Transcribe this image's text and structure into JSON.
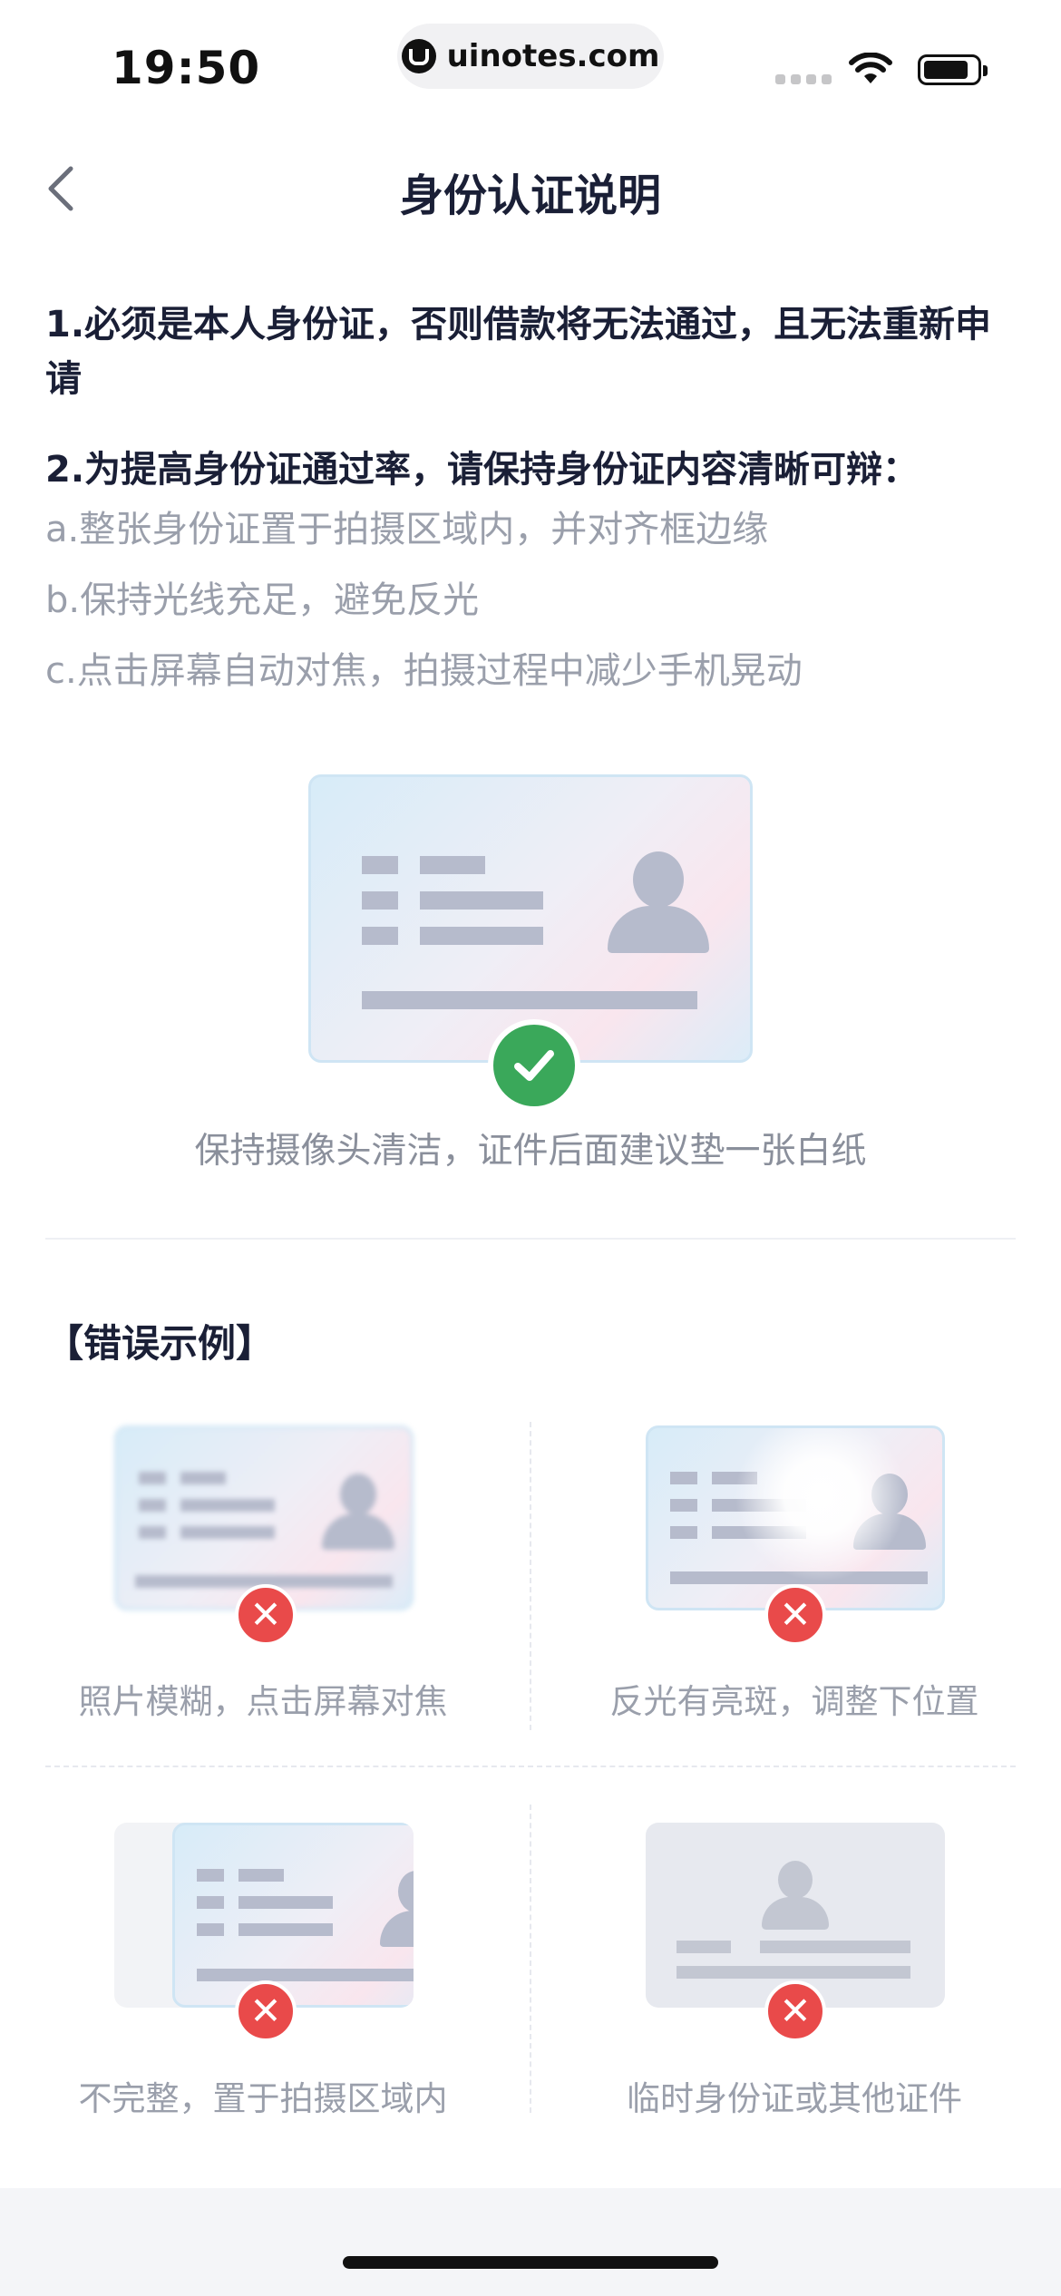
{
  "status_bar": {
    "time": "19:50",
    "url": "uinotes.com"
  },
  "nav": {
    "title": "身份认证说明"
  },
  "rules": {
    "rule1": "1.必须是本人身份证，否则借款将无法通过，且无法重新申请",
    "rule2": "2.为提高身份证通过率，请保持身份证内容清晰可辩：",
    "tips": [
      "a.整张身份证置于拍摄区域内，并对齐框边缘",
      "b.保持光线充足，避免反光",
      "c.点击屏幕自动对焦，拍摄过程中减少手机晃动"
    ]
  },
  "good_example": {
    "caption": "保持摄像头清洁，证件后面建议垫一张白纸"
  },
  "error_section": {
    "title": "【错误示例】",
    "items": [
      {
        "caption": "照片模糊，点击屏幕对焦"
      },
      {
        "caption": "反光有亮斑，调整下位置"
      },
      {
        "caption": "不完整，置于拍摄区域内"
      },
      {
        "caption": "临时身份证或其他证件"
      }
    ]
  },
  "colors": {
    "check": "#3aa85a",
    "error": "#e94a4a",
    "title": "#1a1f36",
    "muted": "#9a9fab"
  },
  "icons": [
    "back-chevron-icon",
    "wifi-icon",
    "battery-icon",
    "check-icon",
    "close-icon",
    "avatar-silhouette-icon"
  ]
}
